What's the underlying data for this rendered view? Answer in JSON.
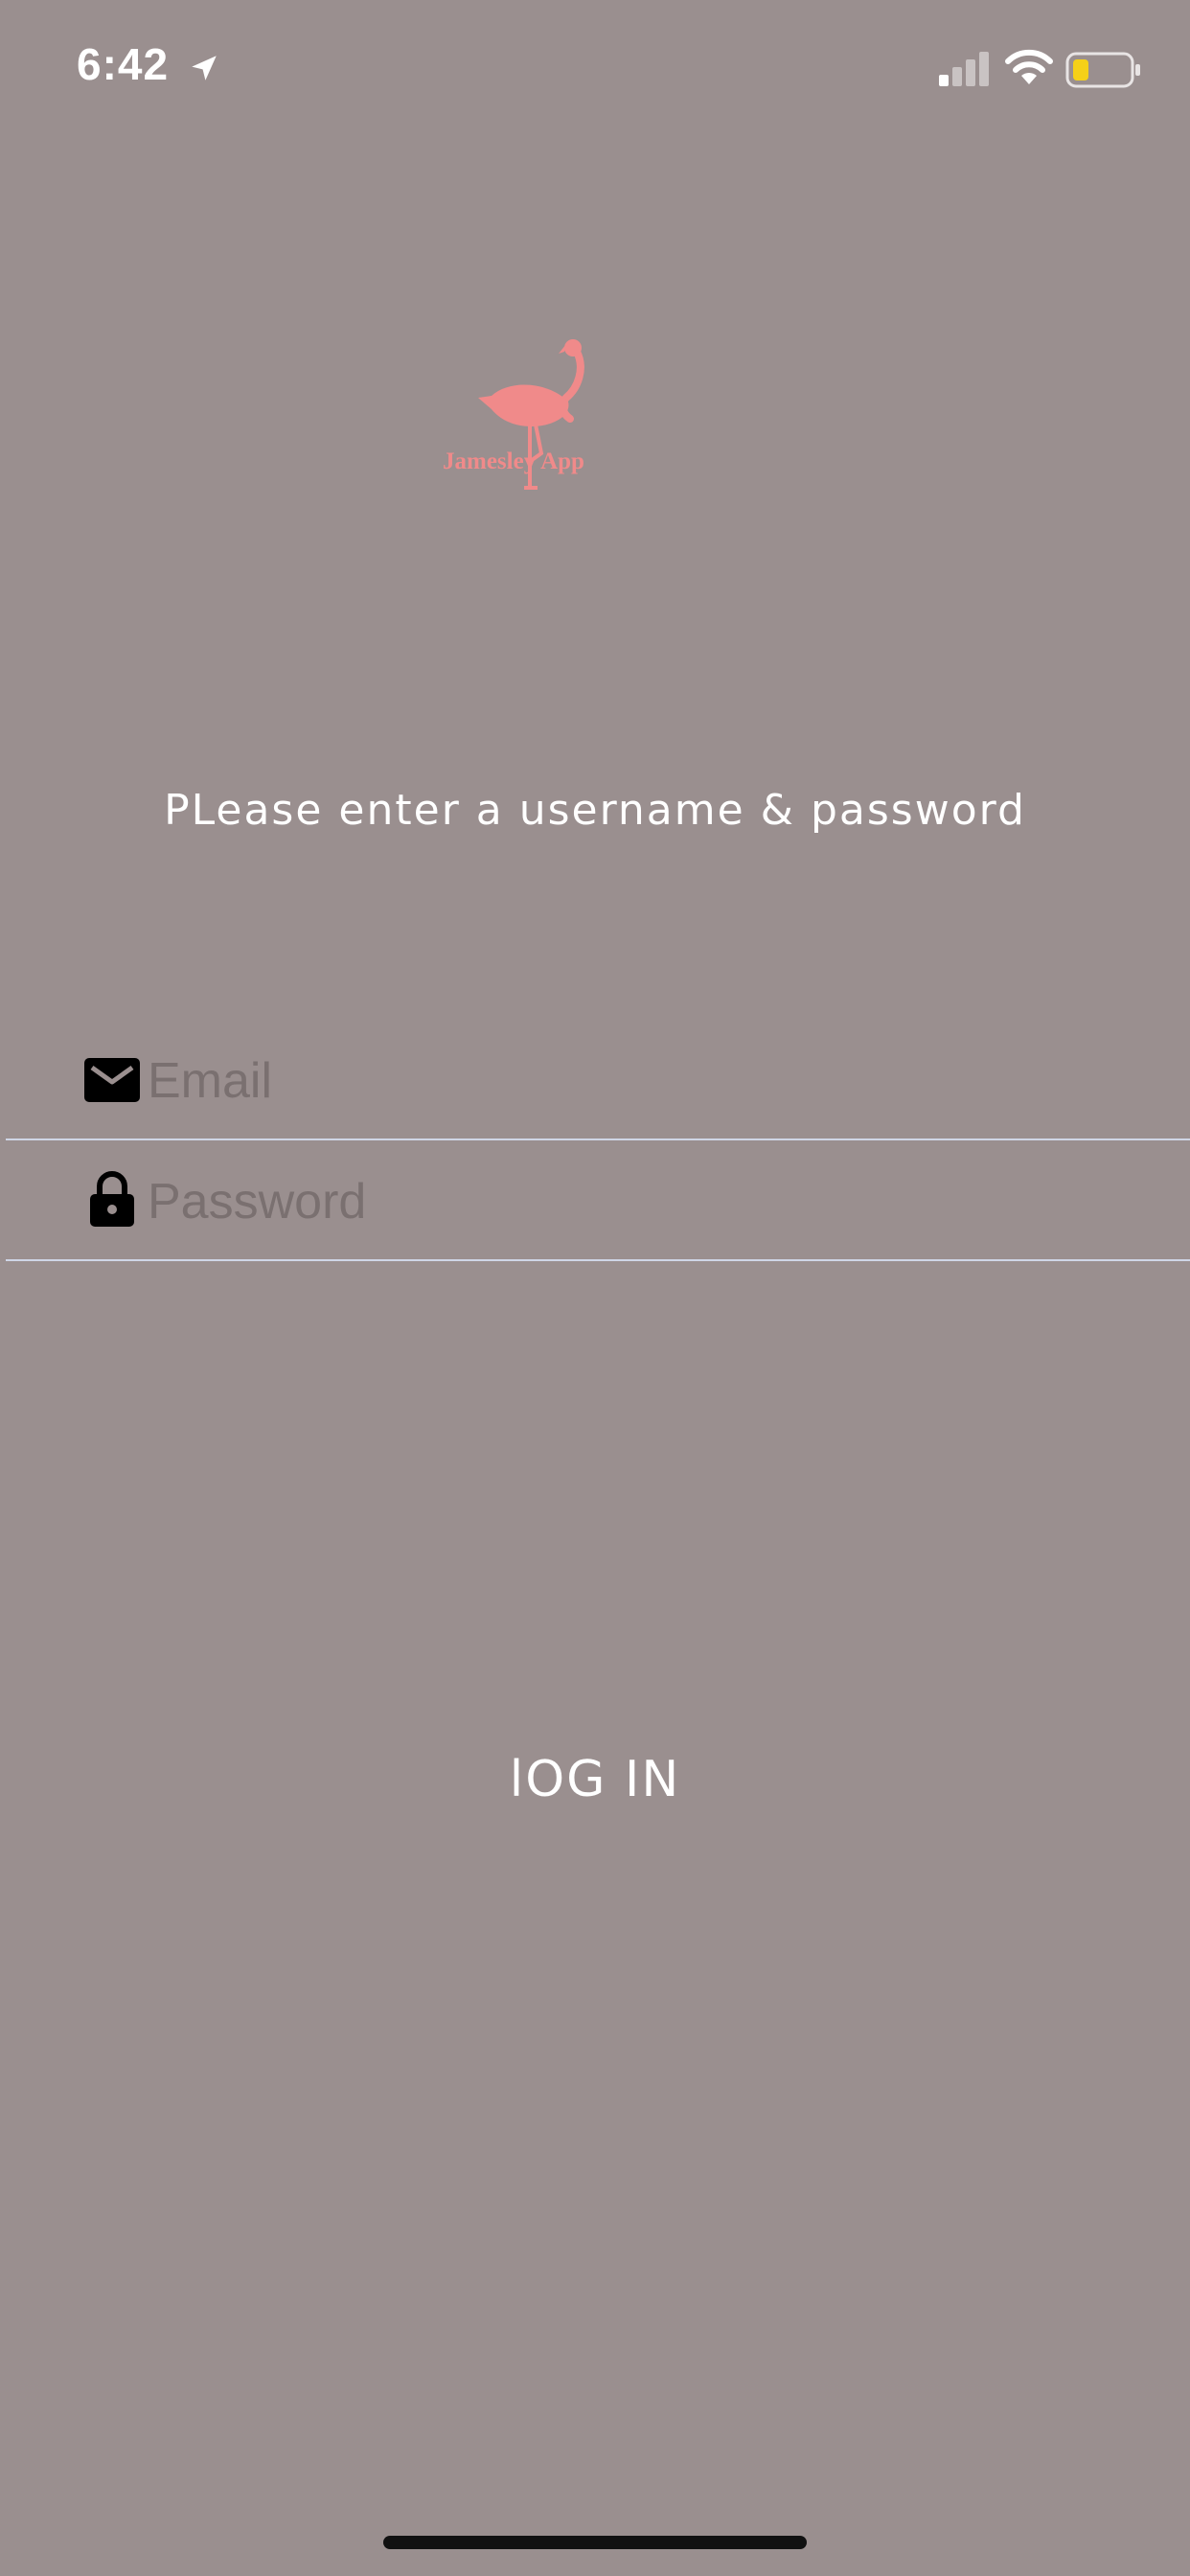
{
  "status_bar": {
    "time": "6:42",
    "icons": [
      "location-arrow-icon",
      "cellular-signal-icon",
      "wifi-icon",
      "battery-icon"
    ],
    "battery_color": "#f5d018"
  },
  "logo": {
    "icon": "flamingo-icon",
    "text": "Jamesley App",
    "color": "#f08a8a"
  },
  "prompt": "PLease enter a username & password",
  "form": {
    "email": {
      "icon": "envelope-icon",
      "placeholder": "Email",
      "value": ""
    },
    "password": {
      "icon": "lock-icon",
      "placeholder": "Password",
      "value": ""
    }
  },
  "login_button": "lOG IN",
  "colors": {
    "background": "#9a8f8f",
    "text": "#ffffff",
    "divider": "#cfd6e6"
  }
}
